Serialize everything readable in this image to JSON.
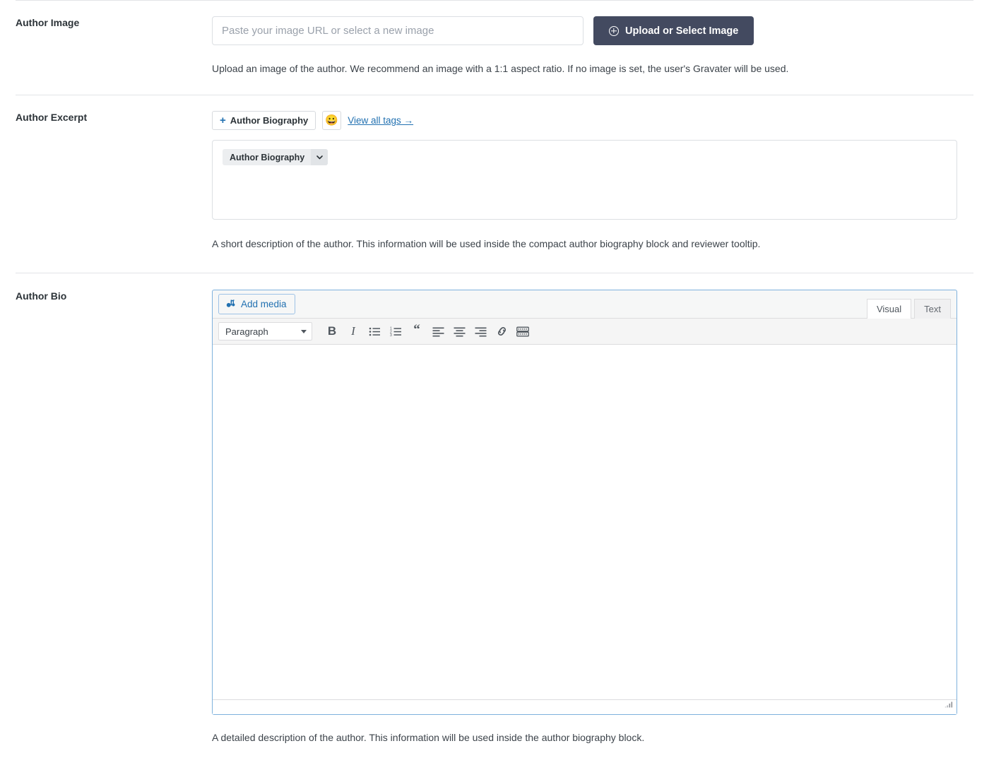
{
  "sections": {
    "author_image": {
      "label": "Author Image",
      "input_placeholder": "Paste your image URL or select a new image",
      "input_value": "",
      "upload_button": "Upload or Select Image",
      "upload_icon": "plus-circle-icon",
      "help": "Upload an image of the author. We recommend an image with a 1:1 aspect ratio. If no image is set, the user's Gravater will be used."
    },
    "author_excerpt": {
      "label": "Author Excerpt",
      "add_tag_button": "Author Biography",
      "add_tag_prefix": "+",
      "emoji_button": "😀",
      "emoji_icon": "grinning-face-emoji-icon",
      "view_all_tags": "View all tags →",
      "chips": [
        {
          "label": "Author Biography",
          "caret_icon": "chevron-down-icon"
        }
      ],
      "help": "A short description of the author. This information will be used inside the compact author biography block and reviewer tooltip."
    },
    "author_bio": {
      "label": "Author Bio",
      "add_media_button": "Add media",
      "add_media_icon": "media-library-icon",
      "tabs": [
        {
          "label": "Visual",
          "active": true
        },
        {
          "label": "Text",
          "active": false
        }
      ],
      "toolbar": {
        "format_select": "Paragraph",
        "buttons": [
          {
            "name": "bold-button",
            "glyph": "B"
          },
          {
            "name": "italic-button",
            "glyph": "I"
          },
          {
            "name": "bulleted-list-button",
            "glyph": ""
          },
          {
            "name": "numbered-list-button",
            "glyph": ""
          },
          {
            "name": "blockquote-button",
            "glyph": "“"
          },
          {
            "name": "align-left-button",
            "glyph": ""
          },
          {
            "name": "align-center-button",
            "glyph": ""
          },
          {
            "name": "align-right-button",
            "glyph": ""
          },
          {
            "name": "insert-link-button",
            "glyph": ""
          },
          {
            "name": "toolbar-toggle-button",
            "glyph": ""
          }
        ]
      },
      "content": "",
      "help": "A detailed description of the author. This information will be used inside the author biography block."
    }
  },
  "colors": {
    "accent_blue": "#2271b1",
    "button_dark": "#434a60",
    "border": "#dcdfe3",
    "focus_ring": "#7eb1dd",
    "text": "#3c434a"
  }
}
